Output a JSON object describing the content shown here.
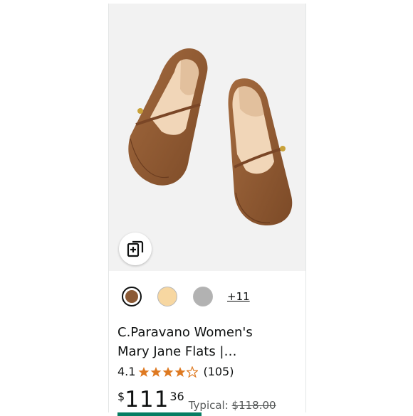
{
  "product": {
    "image_alt": "Brown Mary Jane flats",
    "brand_print": "C.Paravano",
    "title_line1": "C.Paravano Women's",
    "title_line2": "Mary Jane Flats |…",
    "rating": "4.1",
    "rating_count": "(105)",
    "price_symbol": "$",
    "price_whole": "111",
    "price_fraction": "36",
    "typical_label": "Typical: ",
    "typical_price": "$118.00",
    "more_colors": "+11",
    "stars": {
      "full": 4,
      "empty": 1,
      "fill_color": "#de7921",
      "empty_color": "#de7921"
    },
    "swatches": [
      {
        "name": "brown",
        "color": "#8b5a36",
        "selected": true
      },
      {
        "name": "tan",
        "color": "#f7d7a1",
        "selected": false
      },
      {
        "name": "gray",
        "color": "#b2b2b2",
        "selected": false
      }
    ],
    "compare_icon": "add-to-compare-icon",
    "accent_green": "#067d62"
  }
}
